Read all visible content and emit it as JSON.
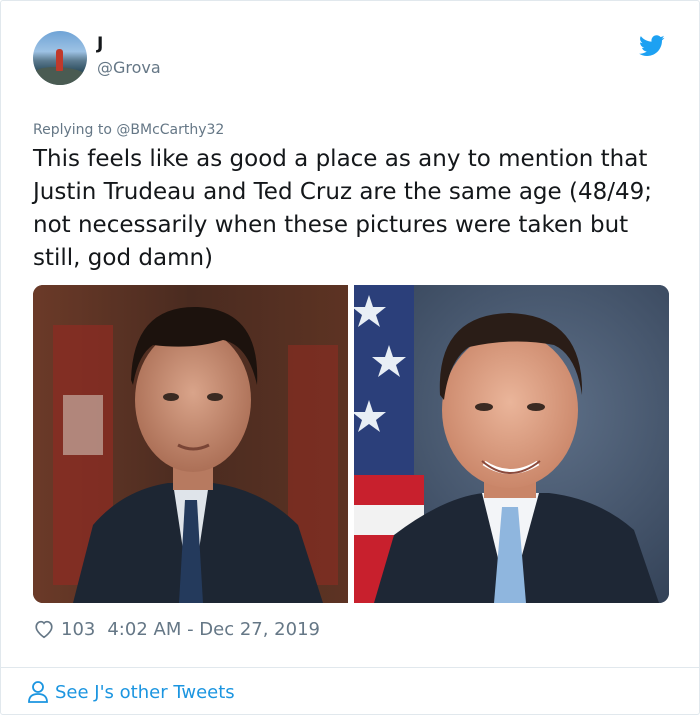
{
  "tweet": {
    "author": {
      "name": "J",
      "handle": "@Grova"
    },
    "reply_prefix": "Replying to",
    "reply_to": "@BMcCarthy32",
    "text": "This feels like as good a place as any to mention that Justin Trudeau and Ted Cruz are the same age (48/49; not necessarily when these pictures were taken but still, god damn)",
    "likes": "103",
    "timestamp": "4:02 AM - Dec 27, 2019",
    "more_link": "See J's other Tweets"
  },
  "colors": {
    "accent": "#1da1f2",
    "link": "#1b95e0",
    "text": "#14171a",
    "secondary": "#657786",
    "border": "#e1e8ed"
  },
  "icons": {
    "brand": "twitter-bird-icon",
    "like": "heart-outline-icon",
    "profile": "person-outline-icon"
  }
}
